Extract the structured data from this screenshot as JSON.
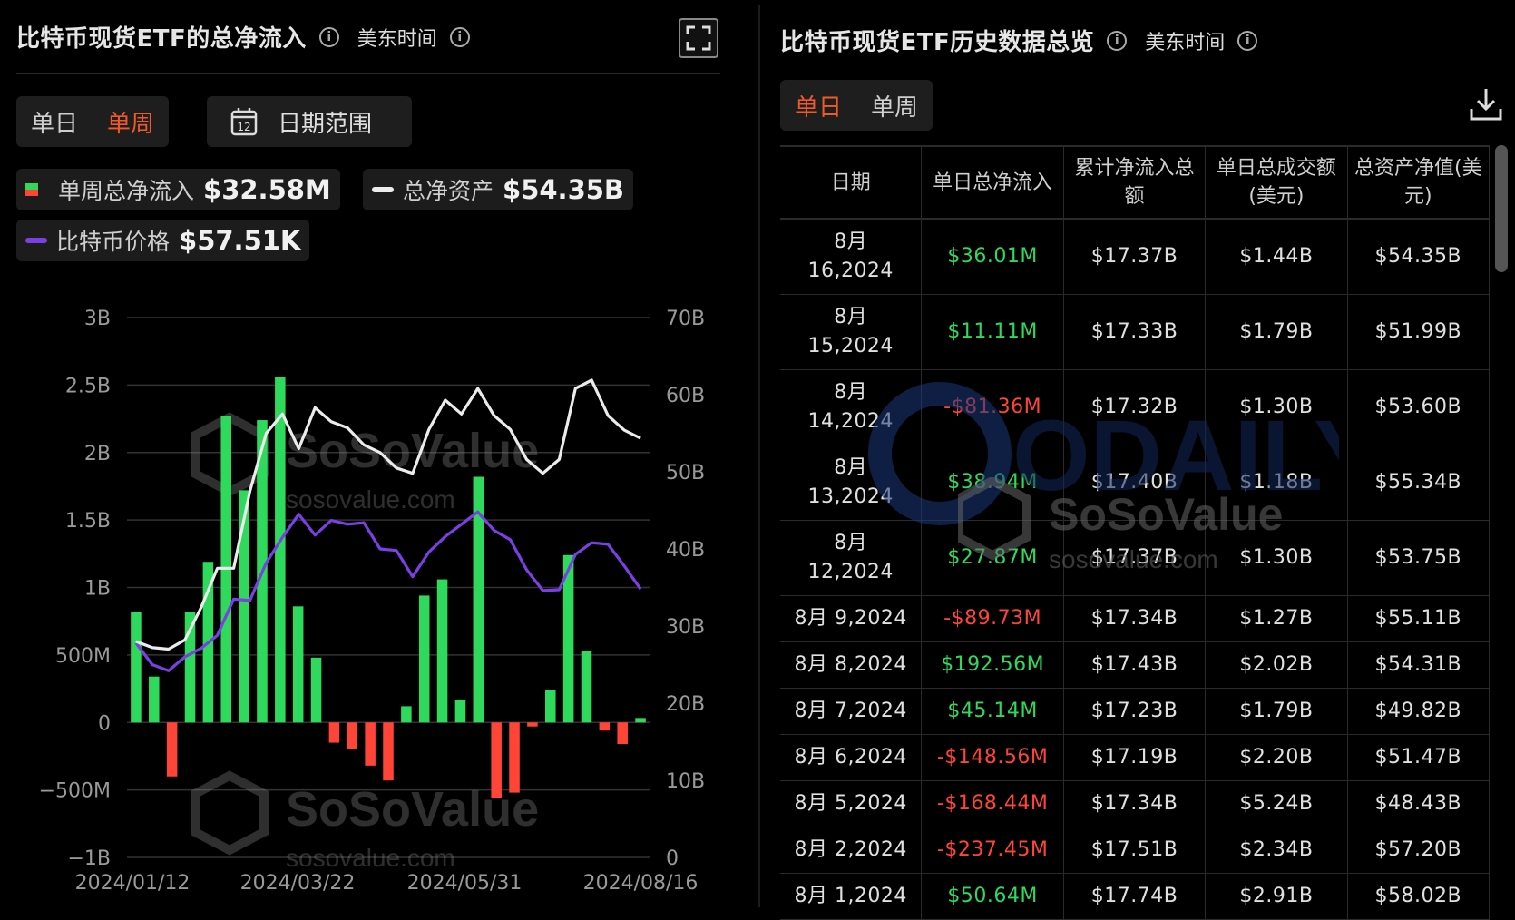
{
  "left": {
    "title": "比特币现货ETF的总净流入",
    "timezone": "美东时间",
    "tabs": [
      "单日",
      "单周"
    ],
    "active_tab": 1,
    "date_range_label": "日期范围",
    "calendar_day": "12",
    "legend": {
      "flow_label": "单周总净流入",
      "flow_value": "$32.58M",
      "assets_label": "总净资产",
      "assets_value": "$54.35B",
      "price_label": "比特币价格",
      "price_value": "$57.51K"
    },
    "watermark_brand": "SoSoValue",
    "watermark_url": "sosovalue.com"
  },
  "right": {
    "title": "比特币现货ETF历史数据总览",
    "timezone": "美东时间",
    "tabs": [
      "单日",
      "单周"
    ],
    "active_tab": 0,
    "headers": [
      "日期",
      "单日总净流入",
      "累计净流入总额",
      "单日总成交额(美元)",
      "总资产净值(美元)"
    ],
    "rows": [
      {
        "date": "8月 16,2024",
        "flow": "$36.01M",
        "cum": "$17.37B",
        "vol": "$1.44B",
        "nav": "$54.35B",
        "sign": "pos"
      },
      {
        "date": "8月 15,2024",
        "flow": "$11.11M",
        "cum": "$17.33B",
        "vol": "$1.79B",
        "nav": "$51.99B",
        "sign": "pos"
      },
      {
        "date": "8月 14,2024",
        "flow": "-$81.36M",
        "cum": "$17.32B",
        "vol": "$1.30B",
        "nav": "$53.60B",
        "sign": "neg"
      },
      {
        "date": "8月 13,2024",
        "flow": "$38.94M",
        "cum": "$17.40B",
        "vol": "$1.18B",
        "nav": "$55.34B",
        "sign": "pos"
      },
      {
        "date": "8月 12,2024",
        "flow": "$27.87M",
        "cum": "$17.37B",
        "vol": "$1.30B",
        "nav": "$53.75B",
        "sign": "pos"
      },
      {
        "date": "8月 9,2024",
        "flow": "-$89.73M",
        "cum": "$17.34B",
        "vol": "$1.27B",
        "nav": "$55.11B",
        "sign": "neg"
      },
      {
        "date": "8月 8,2024",
        "flow": "$192.56M",
        "cum": "$17.43B",
        "vol": "$2.02B",
        "nav": "$54.31B",
        "sign": "pos"
      },
      {
        "date": "8月 7,2024",
        "flow": "$45.14M",
        "cum": "$17.23B",
        "vol": "$1.79B",
        "nav": "$49.82B",
        "sign": "pos"
      },
      {
        "date": "8月 6,2024",
        "flow": "-$148.56M",
        "cum": "$17.19B",
        "vol": "$2.20B",
        "nav": "$51.47B",
        "sign": "neg"
      },
      {
        "date": "8月 5,2024",
        "flow": "-$168.44M",
        "cum": "$17.34B",
        "vol": "$5.24B",
        "nav": "$48.43B",
        "sign": "neg"
      },
      {
        "date": "8月 2,2024",
        "flow": "-$237.45M",
        "cum": "$17.51B",
        "vol": "$2.34B",
        "nav": "$57.20B",
        "sign": "neg"
      },
      {
        "date": "8月 1,2024",
        "flow": "$50.64M",
        "cum": "$17.74B",
        "vol": "$2.91B",
        "nav": "$58.02B",
        "sign": "pos"
      }
    ],
    "watermark_brand": "SoSoValue",
    "watermark_url": "sosovalue.com",
    "watermark_odaily": "ODAILY"
  },
  "chart_data": {
    "type": "bar",
    "x_tick_labels": [
      "2024/01/12",
      "2024/03/22",
      "2024/05/31",
      "2024/08/16"
    ],
    "y_left_ticks": [
      "3B",
      "2.5B",
      "2B",
      "1.5B",
      "1B",
      "500M",
      "0",
      "−500M",
      "−1B"
    ],
    "y_left_range": [
      -1000,
      3000
    ],
    "y_left_unit": "M",
    "y_right_ticks": [
      "70B",
      "60B",
      "50B",
      "40B",
      "30B",
      "20B",
      "10B",
      "0"
    ],
    "y_right_range": [
      0,
      70
    ],
    "colors": {
      "inflow": "#2fd95c",
      "outflow": "#ff4438",
      "assets": "#ececec",
      "price": "#7b3fe4"
    },
    "series": [
      {
        "name": "单周总净流入",
        "values": [
          820,
          340,
          -400,
          820,
          1190,
          2270,
          1720,
          2240,
          2560,
          860,
          480,
          -150,
          -200,
          -320,
          -430,
          120,
          940,
          1060,
          170,
          1820,
          -560,
          -520,
          -30,
          240,
          1240,
          530,
          -60,
          -160,
          33
        ]
      },
      {
        "name": "总净资产",
        "values": [
          28,
          27.2,
          27,
          28.2,
          32.4,
          37.5,
          37.5,
          47.5,
          55,
          57.5,
          53,
          58.3,
          56.5,
          55.7,
          53.5,
          52.5,
          50.5,
          49.8,
          55.5,
          59.3,
          57.5,
          60.8,
          57.3,
          55.5,
          51.6,
          49.8,
          51.6,
          60.8,
          61.9,
          57.3,
          55.4,
          54.35
        ]
      },
      {
        "name": "比特币价格",
        "values": [
          27.8,
          25,
          24.2,
          26,
          27.1,
          28.8,
          33.5,
          33.3,
          38.2,
          41.5,
          44.5,
          41.8,
          43.7,
          43.2,
          43.4,
          40,
          39.8,
          36.4,
          39.6,
          41.6,
          43.2,
          44.8,
          42.4,
          41.2,
          37.3,
          34.6,
          34.7,
          39.3,
          40.8,
          40.6,
          37.8,
          34.8
        ]
      }
    ]
  }
}
